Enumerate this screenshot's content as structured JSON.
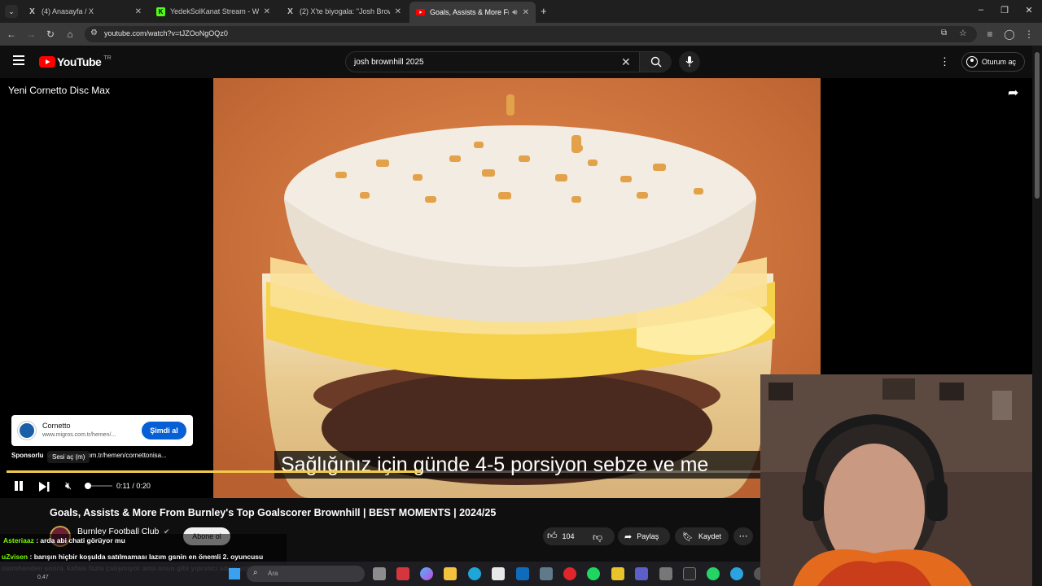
{
  "browser": {
    "tabs": [
      {
        "title": "(4) Anasayfa / X",
        "favicon": "X",
        "active": false
      },
      {
        "title": "YedekSolKanat Stream - Watch",
        "favicon": "K",
        "active": false
      },
      {
        "title": "(2) X'te biyogala: \"Josh Brownhi",
        "favicon": "X",
        "active": false
      },
      {
        "title": "Goals, Assists & More From",
        "favicon": "yt",
        "active": true
      }
    ],
    "url": "youtube.com/watch?v=tJZOoNgOQz0"
  },
  "youtube": {
    "logo": "YouTube",
    "logo_region": "TR",
    "search_query": "josh brownhill 2025",
    "signin_label": "Oturum aç"
  },
  "ad": {
    "title": "Yeni Cornetto Disc Max",
    "brand": "Cornetto",
    "link": "www.migros.com.tr/hemen/...",
    "cta": "Şimdi al",
    "sponsored_label": "Sponsorlu",
    "sponsored_url": "www.migros.com.tr/hemen/cornettonisa...",
    "caption": "Sağlığınız için günde 4-5 porsiyon sebze ve me",
    "tooltip": "Sesi aç (m)",
    "time": "0:11 / 0:20",
    "progress": 0.55
  },
  "video": {
    "title": "Goals, Assists & More From Burnley's Top Goalscorer Brownhill | BEST MOMENTS | 2024/25",
    "channel": "Burnley Football Club",
    "subscribe_label": "Abone ol",
    "likes": "104",
    "share_label": "Paylaş",
    "save_label": "Kaydet"
  },
  "chat": [
    {
      "user": "Asteriaaz",
      "user_color": "#7CFC00",
      "text": "arda abi chati görüyor mu"
    },
    {
      "user": "uZvisen",
      "user_color": "#7CFC00",
      "text": "barışın hiçbir koşulda satılmaması lazım gsnin en önemli 2. oyuncusu osimhenden sonra. kafası fazla çalışmıyor ama onun gibi yıpratıcı adam yok dünyada"
    }
  ],
  "taskbar": {
    "search_placeholder": "Ara",
    "weather_temp": "0,47"
  },
  "colors": {
    "yt_red": "#FF0000",
    "ad_progress": "#F2C94C",
    "cta_blue": "#065FD4"
  }
}
